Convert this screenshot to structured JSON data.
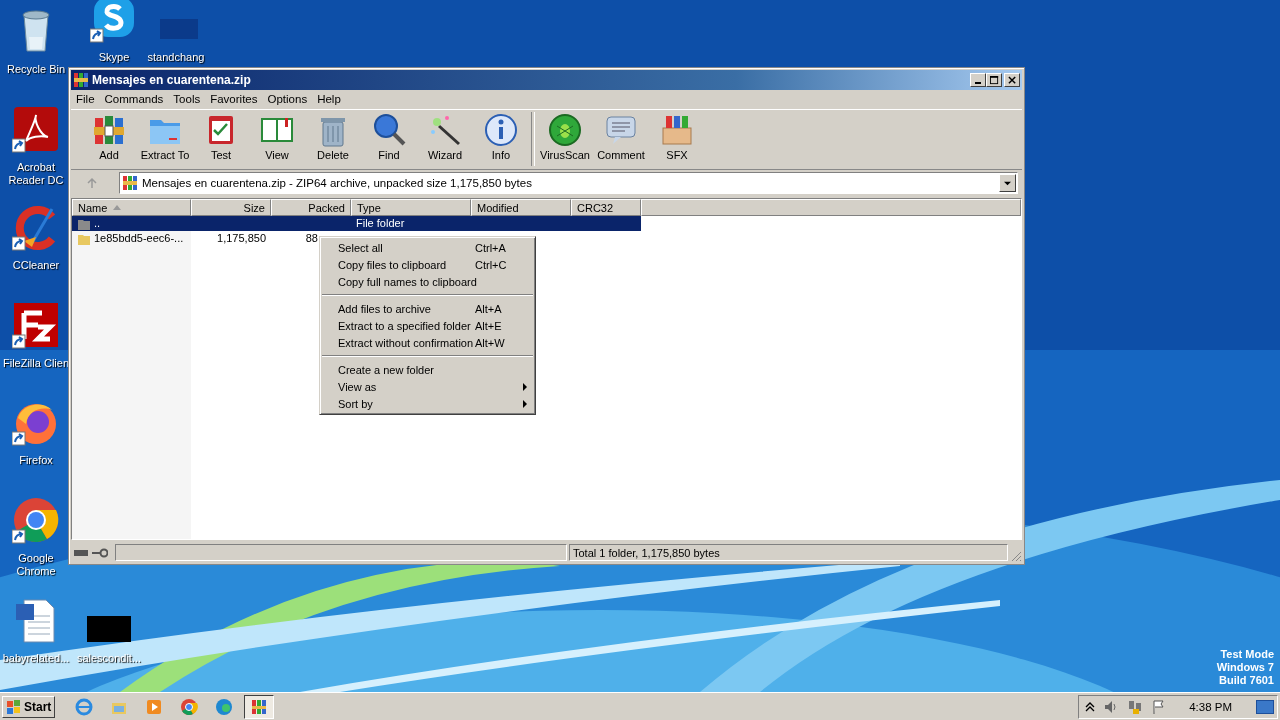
{
  "desktop": {
    "icons": [
      {
        "label": "Recycle Bin",
        "kind": "recycle",
        "shortcut": false
      },
      {
        "label": "Skype",
        "kind": "skype",
        "shortcut": true
      },
      {
        "label": "standchang",
        "kind": "darkblue",
        "shortcut": false
      },
      {
        "label": "Acrobat Reader DC",
        "kind": "acrobat",
        "shortcut": true
      },
      {
        "label": "CCleaner",
        "kind": "ccleaner",
        "shortcut": true
      },
      {
        "label": "FileZilla Clien",
        "kind": "filezilla",
        "shortcut": true
      },
      {
        "label": "Firefox",
        "kind": "firefox",
        "shortcut": true
      },
      {
        "label": "Google Chrome",
        "kind": "chrome",
        "shortcut": true
      },
      {
        "label": "babyrelated...",
        "kind": "word",
        "shortcut": false
      },
      {
        "label": "salescondit...",
        "kind": "black",
        "shortcut": false
      }
    ],
    "os_notice": [
      "Test Mode",
      "Windows 7",
      "Build 7601"
    ]
  },
  "window": {
    "title": "Mensajes en cuarentena.zip",
    "menu": [
      "File",
      "Commands",
      "Tools",
      "Favorites",
      "Options",
      "Help"
    ],
    "toolbar": [
      {
        "label": "Add",
        "kind": "add"
      },
      {
        "label": "Extract To",
        "kind": "extract"
      },
      {
        "label": "Test",
        "kind": "test"
      },
      {
        "label": "View",
        "kind": "view"
      },
      {
        "label": "Delete",
        "kind": "delete"
      },
      {
        "label": "Find",
        "kind": "find"
      },
      {
        "label": "Wizard",
        "kind": "wizard"
      },
      {
        "label": "Info",
        "kind": "info"
      },
      {
        "label": "VirusScan",
        "kind": "virus"
      },
      {
        "label": "Comment",
        "kind": "comment"
      },
      {
        "label": "SFX",
        "kind": "sfx"
      }
    ],
    "address": "Mensajes en cuarentena.zip - ZIP64 archive, unpacked size 1,175,850 bytes",
    "table": {
      "columns": [
        {
          "label": "Name",
          "sorted": true
        },
        {
          "label": "Size",
          "sorted": false
        },
        {
          "label": "Packed",
          "sorted": false
        },
        {
          "label": "Type",
          "sorted": false
        },
        {
          "label": "Modified",
          "sorted": false
        },
        {
          "label": "CRC32",
          "sorted": false
        }
      ],
      "rows": [
        {
          "selected": true,
          "kind": "up",
          "cells": [
            "..",
            "",
            "",
            "File folder",
            "",
            ""
          ]
        },
        {
          "selected": false,
          "kind": "folder",
          "cells": [
            "1e85bdd5-eec6-...",
            "1,175,850",
            "88",
            "",
            "",
            ""
          ]
        }
      ]
    },
    "context_menu": [
      {
        "kind": "item",
        "label": "Select all",
        "shortcut": "Ctrl+A",
        "submenu": false
      },
      {
        "kind": "item",
        "label": "Copy files to clipboard",
        "shortcut": "Ctrl+C",
        "submenu": false
      },
      {
        "kind": "item",
        "label": "Copy full names to clipboard",
        "submenu": false
      },
      {
        "kind": "separator"
      },
      {
        "kind": "item",
        "label": "Add files to archive",
        "shortcut": "Alt+A",
        "submenu": false
      },
      {
        "kind": "item",
        "label": "Extract to a specified folder",
        "shortcut": "Alt+E",
        "submenu": false
      },
      {
        "kind": "item",
        "label": "Extract without confirmation",
        "shortcut": "Alt+W",
        "submenu": false
      },
      {
        "kind": "separator"
      },
      {
        "kind": "item",
        "label": "Create a new folder",
        "submenu": false
      },
      {
        "kind": "item",
        "label": "View as",
        "submenu": true
      },
      {
        "kind": "item",
        "label": "Sort by",
        "submenu": true
      }
    ],
    "status_bar": "Total 1 folder, 1,175,850 bytes"
  },
  "taskbar": {
    "start": "Start",
    "apps": [
      {
        "kind": "ie",
        "active": false
      },
      {
        "kind": "explorer",
        "active": false
      },
      {
        "kind": "media",
        "active": false
      },
      {
        "kind": "chrome",
        "active": false
      },
      {
        "kind": "edge",
        "active": false
      },
      {
        "kind": "winrar",
        "active": true
      }
    ],
    "clock": "4:38 PM"
  }
}
